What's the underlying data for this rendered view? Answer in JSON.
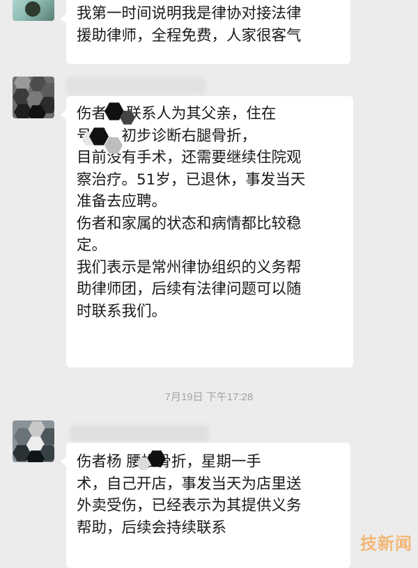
{
  "chat": {
    "messages": [
      {
        "lines": [
          "我第一时间说明我是律协对接法律",
          "援助律师，全程免费，人家很客气"
        ]
      },
      {
        "lines": [
          "伤者    ，联系人为其父亲，住在",
          "         号楼，初步诊断右腿骨折，",
          "目前没有手术，还需要继续住院观",
          "察治疗。51岁，已退休，事发当天",
          "准备去应聘。",
          "伤者和家属的状态和病情都比较稳",
          "定。",
          "我们表示是常州律协组织的义务帮",
          "助律师团，后续有法律问题可以随",
          "时联系我们。"
        ]
      },
      {
        "lines": [
          "伤者杨      腰椎骨折，星期一手",
          "术，自己开店，事发当天为店里送",
          "外卖受伤，已经表示为其提供义务",
          "帮助，后续会持续联系"
        ]
      }
    ],
    "timestamp": "7月19日 下午17:28",
    "watermark": "技新闻"
  },
  "colors": {
    "background": "#ececec",
    "bubble": "#ffffff",
    "text": "#1a1a1a",
    "timestamp": "#a2a2a2",
    "watermark": "#fa8c14"
  }
}
